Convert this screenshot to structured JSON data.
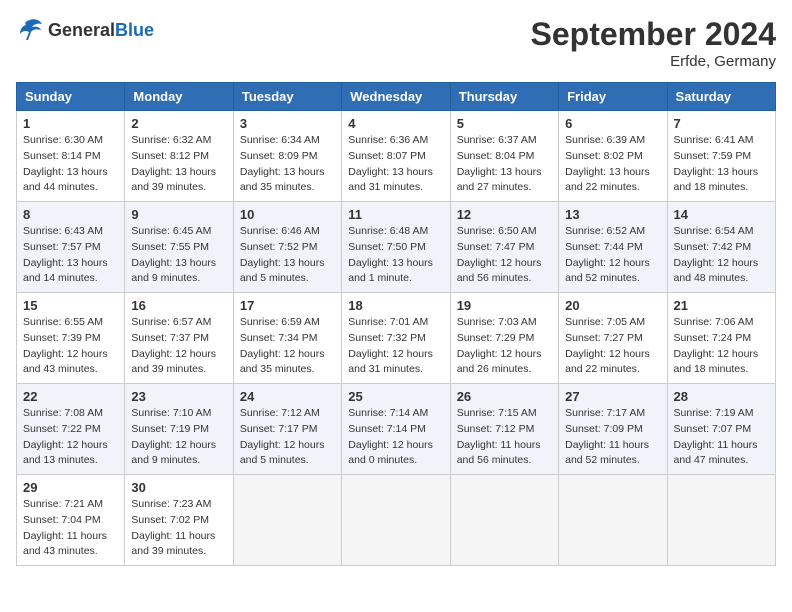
{
  "header": {
    "logo_general": "General",
    "logo_blue": "Blue",
    "month_title": "September 2024",
    "location": "Erfde, Germany"
  },
  "columns": [
    "Sunday",
    "Monday",
    "Tuesday",
    "Wednesday",
    "Thursday",
    "Friday",
    "Saturday"
  ],
  "weeks": [
    [
      {
        "day": "1",
        "sunrise": "6:30 AM",
        "sunset": "8:14 PM",
        "daylight": "13 hours and 44 minutes."
      },
      {
        "day": "2",
        "sunrise": "6:32 AM",
        "sunset": "8:12 PM",
        "daylight": "13 hours and 39 minutes."
      },
      {
        "day": "3",
        "sunrise": "6:34 AM",
        "sunset": "8:09 PM",
        "daylight": "13 hours and 35 minutes."
      },
      {
        "day": "4",
        "sunrise": "6:36 AM",
        "sunset": "8:07 PM",
        "daylight": "13 hours and 31 minutes."
      },
      {
        "day": "5",
        "sunrise": "6:37 AM",
        "sunset": "8:04 PM",
        "daylight": "13 hours and 27 minutes."
      },
      {
        "day": "6",
        "sunrise": "6:39 AM",
        "sunset": "8:02 PM",
        "daylight": "13 hours and 22 minutes."
      },
      {
        "day": "7",
        "sunrise": "6:41 AM",
        "sunset": "7:59 PM",
        "daylight": "13 hours and 18 minutes."
      }
    ],
    [
      {
        "day": "8",
        "sunrise": "6:43 AM",
        "sunset": "7:57 PM",
        "daylight": "13 hours and 14 minutes."
      },
      {
        "day": "9",
        "sunrise": "6:45 AM",
        "sunset": "7:55 PM",
        "daylight": "13 hours and 9 minutes."
      },
      {
        "day": "10",
        "sunrise": "6:46 AM",
        "sunset": "7:52 PM",
        "daylight": "13 hours and 5 minutes."
      },
      {
        "day": "11",
        "sunrise": "6:48 AM",
        "sunset": "7:50 PM",
        "daylight": "13 hours and 1 minute."
      },
      {
        "day": "12",
        "sunrise": "6:50 AM",
        "sunset": "7:47 PM",
        "daylight": "12 hours and 56 minutes."
      },
      {
        "day": "13",
        "sunrise": "6:52 AM",
        "sunset": "7:44 PM",
        "daylight": "12 hours and 52 minutes."
      },
      {
        "day": "14",
        "sunrise": "6:54 AM",
        "sunset": "7:42 PM",
        "daylight": "12 hours and 48 minutes."
      }
    ],
    [
      {
        "day": "15",
        "sunrise": "6:55 AM",
        "sunset": "7:39 PM",
        "daylight": "12 hours and 43 minutes."
      },
      {
        "day": "16",
        "sunrise": "6:57 AM",
        "sunset": "7:37 PM",
        "daylight": "12 hours and 39 minutes."
      },
      {
        "day": "17",
        "sunrise": "6:59 AM",
        "sunset": "7:34 PM",
        "daylight": "12 hours and 35 minutes."
      },
      {
        "day": "18",
        "sunrise": "7:01 AM",
        "sunset": "7:32 PM",
        "daylight": "12 hours and 31 minutes."
      },
      {
        "day": "19",
        "sunrise": "7:03 AM",
        "sunset": "7:29 PM",
        "daylight": "12 hours and 26 minutes."
      },
      {
        "day": "20",
        "sunrise": "7:05 AM",
        "sunset": "7:27 PM",
        "daylight": "12 hours and 22 minutes."
      },
      {
        "day": "21",
        "sunrise": "7:06 AM",
        "sunset": "7:24 PM",
        "daylight": "12 hours and 18 minutes."
      }
    ],
    [
      {
        "day": "22",
        "sunrise": "7:08 AM",
        "sunset": "7:22 PM",
        "daylight": "12 hours and 13 minutes."
      },
      {
        "day": "23",
        "sunrise": "7:10 AM",
        "sunset": "7:19 PM",
        "daylight": "12 hours and 9 minutes."
      },
      {
        "day": "24",
        "sunrise": "7:12 AM",
        "sunset": "7:17 PM",
        "daylight": "12 hours and 5 minutes."
      },
      {
        "day": "25",
        "sunrise": "7:14 AM",
        "sunset": "7:14 PM",
        "daylight": "12 hours and 0 minutes."
      },
      {
        "day": "26",
        "sunrise": "7:15 AM",
        "sunset": "7:12 PM",
        "daylight": "11 hours and 56 minutes."
      },
      {
        "day": "27",
        "sunrise": "7:17 AM",
        "sunset": "7:09 PM",
        "daylight": "11 hours and 52 minutes."
      },
      {
        "day": "28",
        "sunrise": "7:19 AM",
        "sunset": "7:07 PM",
        "daylight": "11 hours and 47 minutes."
      }
    ],
    [
      {
        "day": "29",
        "sunrise": "7:21 AM",
        "sunset": "7:04 PM",
        "daylight": "11 hours and 43 minutes."
      },
      {
        "day": "30",
        "sunrise": "7:23 AM",
        "sunset": "7:02 PM",
        "daylight": "11 hours and 39 minutes."
      },
      null,
      null,
      null,
      null,
      null
    ]
  ]
}
